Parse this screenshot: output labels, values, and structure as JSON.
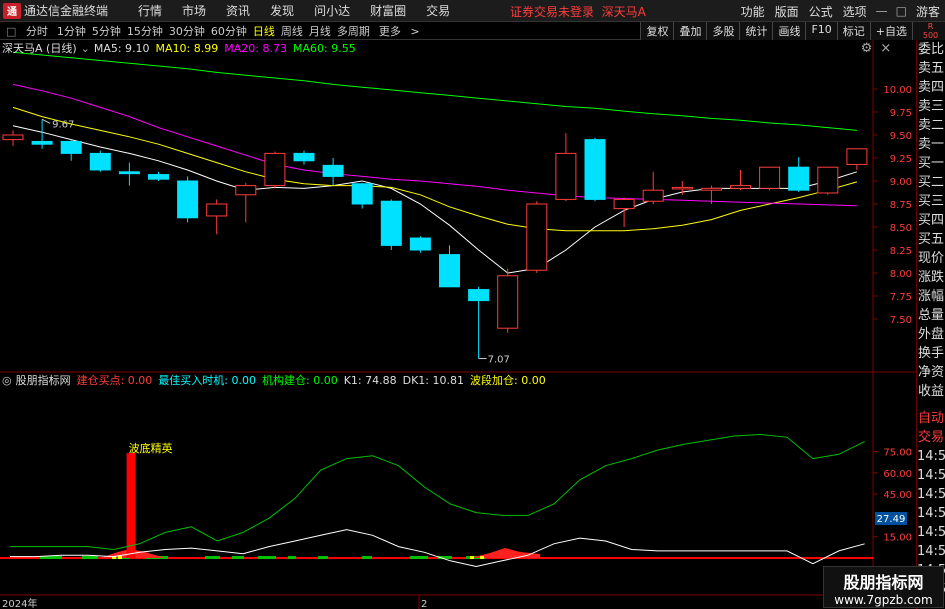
{
  "app": {
    "title": "通达信金融终端",
    "broker_status": "证券交易未登录",
    "stock_tag": "深天马A"
  },
  "menu": [
    "行情",
    "市场",
    "资讯",
    "发现",
    "问小达",
    "财富圈",
    "交易"
  ],
  "menu_right": [
    "功能",
    "版面",
    "公式",
    "选项",
    "游客"
  ],
  "periods": [
    "分时",
    "1分钟",
    "5分钟",
    "15分钟",
    "30分钟",
    "60分钟",
    "日线",
    "周线",
    "月线",
    "多周期",
    "更多"
  ],
  "active_period": "日线",
  "toolbar_right": [
    "复权",
    "叠加",
    "多股",
    "统计",
    "画线",
    "F10",
    "标记",
    "+自选",
    "返回"
  ],
  "right_badge": {
    "top": "R",
    "bottom": "500"
  },
  "legend": {
    "stock": "深天马A (日线)",
    "ma5": "MA5: 9.10",
    "ma10": "MA10: 8.99",
    "ma20": "MA20: 8.73",
    "ma60": "MA60: 9.55"
  },
  "legend2": {
    "name": "股朋指标网",
    "a": "建仓买点: 0.00",
    "b": "最佳买入时机: 0.00",
    "c": "机构建仓: 0.00",
    "k1": "K1: 74.88",
    "dk1": "DK1: 10.81",
    "d": "波段加仓: 0.00"
  },
  "right_panel": [
    "委比",
    "卖五",
    "卖四",
    "卖三",
    "卖二",
    "卖一",
    "买一",
    "买二",
    "买三",
    "买四",
    "买五",
    "现价",
    "涨跌",
    "涨幅",
    "总量",
    "外盘",
    "换手",
    "净资",
    "收益"
  ],
  "right_panel2": [
    "自动",
    "交易",
    "14:56",
    "14:56",
    "14:56",
    "14:56",
    "14:56",
    "14:56",
    "14:56",
    "14:56"
  ],
  "watermark": {
    "line1": "股朋指标网",
    "line2": "www.7gpzb.com"
  },
  "bottom": {
    "year": "2024年",
    "mark": "2"
  },
  "annotation": "波底精英",
  "colors": {
    "up": "#ff3c3c",
    "down": "#00e0ff",
    "ma5": "#ffffff",
    "ma10": "#ffff00",
    "ma20": "#ff00ff",
    "ma60": "#00ff00"
  },
  "chart_data": [
    {
      "type": "candlestick",
      "title": "深天马A (日线)",
      "ylim": [
        7.07,
        9.67
      ],
      "yticks": [
        7.5,
        7.75,
        8.0,
        8.25,
        8.5,
        8.75,
        9.0,
        9.25,
        9.5,
        9.75,
        10.0
      ],
      "high_label": "9.67",
      "low_label": "7.07",
      "candles": [
        {
          "o": 9.45,
          "c": 9.5,
          "h": 9.55,
          "l": 9.38
        },
        {
          "o": 9.43,
          "c": 9.4,
          "h": 9.67,
          "l": 9.35
        },
        {
          "o": 9.43,
          "c": 9.3,
          "h": 9.45,
          "l": 9.22
        },
        {
          "o": 9.3,
          "c": 9.12,
          "h": 9.33,
          "l": 9.1
        },
        {
          "o": 9.1,
          "c": 9.08,
          "h": 9.2,
          "l": 8.95
        },
        {
          "o": 9.07,
          "c": 9.02,
          "h": 9.1,
          "l": 9.0
        },
        {
          "o": 9.0,
          "c": 8.6,
          "h": 9.05,
          "l": 8.55
        },
        {
          "o": 8.62,
          "c": 8.75,
          "h": 8.8,
          "l": 8.42
        },
        {
          "o": 8.85,
          "c": 8.95,
          "h": 8.98,
          "l": 8.55
        },
        {
          "o": 8.95,
          "c": 9.3,
          "h": 9.32,
          "l": 8.92
        },
        {
          "o": 9.3,
          "c": 9.22,
          "h": 9.33,
          "l": 9.18
        },
        {
          "o": 9.17,
          "c": 9.05,
          "h": 9.25,
          "l": 8.95
        },
        {
          "o": 8.97,
          "c": 8.75,
          "h": 8.98,
          "l": 8.7
        },
        {
          "o": 8.78,
          "c": 8.3,
          "h": 8.8,
          "l": 8.25
        },
        {
          "o": 8.38,
          "c": 8.25,
          "h": 8.4,
          "l": 8.22
        },
        {
          "o": 8.2,
          "c": 7.85,
          "h": 8.3,
          "l": 7.85
        },
        {
          "o": 7.82,
          "c": 7.7,
          "h": 7.85,
          "l": 7.07
        },
        {
          "o": 7.4,
          "c": 7.97,
          "h": 8.05,
          "l": 7.35
        },
        {
          "o": 8.03,
          "c": 8.75,
          "h": 8.78,
          "l": 8.0
        },
        {
          "o": 8.8,
          "c": 9.3,
          "h": 9.52,
          "l": 8.78
        },
        {
          "o": 9.45,
          "c": 8.8,
          "h": 9.47,
          "l": 8.78
        },
        {
          "o": 8.7,
          "c": 8.8,
          "h": 8.82,
          "l": 8.5
        },
        {
          "o": 8.78,
          "c": 8.9,
          "h": 9.1,
          "l": 8.75
        },
        {
          "o": 8.92,
          "c": 8.93,
          "h": 9.0,
          "l": 8.85
        },
        {
          "o": 8.9,
          "c": 8.92,
          "h": 8.95,
          "l": 8.75
        },
        {
          "o": 8.92,
          "c": 8.95,
          "h": 9.12,
          "l": 8.9
        },
        {
          "o": 8.92,
          "c": 9.15,
          "h": 9.15,
          "l": 8.9
        },
        {
          "o": 9.15,
          "c": 8.9,
          "h": 9.26,
          "l": 8.88
        },
        {
          "o": 8.87,
          "c": 9.15,
          "h": 9.15,
          "l": 8.85
        },
        {
          "o": 9.18,
          "c": 9.35,
          "h": 9.35,
          "l": 9.12
        }
      ],
      "series": [
        {
          "name": "MA5",
          "values": [
            9.6,
            9.53,
            9.45,
            9.37,
            9.3,
            9.22,
            9.12,
            9.0,
            8.9,
            8.93,
            8.92,
            8.95,
            9.0,
            8.92,
            8.75,
            8.52,
            8.25,
            8.0,
            8.05,
            8.25,
            8.5,
            8.68,
            8.8,
            8.88,
            8.92,
            8.92,
            8.92,
            8.92,
            9.0,
            9.1
          ]
        },
        {
          "name": "MA10",
          "values": [
            9.8,
            9.7,
            9.62,
            9.55,
            9.48,
            9.4,
            9.3,
            9.2,
            9.1,
            9.02,
            8.97,
            8.95,
            8.95,
            8.93,
            8.85,
            8.72,
            8.62,
            8.53,
            8.48,
            8.46,
            8.46,
            8.46,
            8.48,
            8.52,
            8.58,
            8.68,
            8.75,
            8.82,
            8.9,
            8.99
          ]
        },
        {
          "name": "MA20",
          "values": [
            10.05,
            9.98,
            9.9,
            9.8,
            9.7,
            9.58,
            9.48,
            9.38,
            9.28,
            9.18,
            9.12,
            9.08,
            9.05,
            9.02,
            9.0,
            8.97,
            8.94,
            8.9,
            8.87,
            8.84,
            8.82,
            8.81,
            8.8,
            8.79,
            8.78,
            8.77,
            8.76,
            8.75,
            8.74,
            8.73
          ]
        },
        {
          "name": "MA60",
          "values": [
            10.4,
            10.37,
            10.34,
            10.31,
            10.28,
            10.25,
            10.22,
            10.18,
            10.15,
            10.12,
            10.09,
            10.05,
            10.02,
            9.99,
            9.96,
            9.93,
            9.9,
            9.87,
            9.84,
            9.81,
            9.79,
            9.76,
            9.73,
            9.71,
            9.68,
            9.66,
            9.63,
            9.61,
            9.58,
            9.55
          ]
        }
      ]
    },
    {
      "type": "line",
      "title": "股朋指标网",
      "yticks": [
        15.0,
        45.0,
        60.0,
        75.0
      ],
      "highlight_tick": "27.49",
      "series": [
        {
          "name": "K1",
          "values": [
            8,
            8,
            8,
            8,
            6,
            10,
            18,
            22,
            12,
            18,
            28,
            42,
            62,
            70,
            72,
            65,
            50,
            38,
            32,
            30,
            30,
            38,
            55,
            65,
            70,
            76,
            80,
            83,
            86,
            87,
            85,
            70,
            73,
            82
          ]
        },
        {
          "name": "DK1",
          "values": [
            1,
            1,
            2,
            2,
            1,
            4,
            6,
            7,
            5,
            3,
            8,
            12,
            16,
            20,
            16,
            8,
            4,
            -2,
            -6,
            -2,
            2,
            10,
            14,
            12,
            6,
            5,
            5,
            5,
            5,
            5,
            5,
            -4,
            5,
            10
          ]
        }
      ],
      "signal_bar": {
        "index": 4,
        "label": "波底精英"
      }
    }
  ]
}
